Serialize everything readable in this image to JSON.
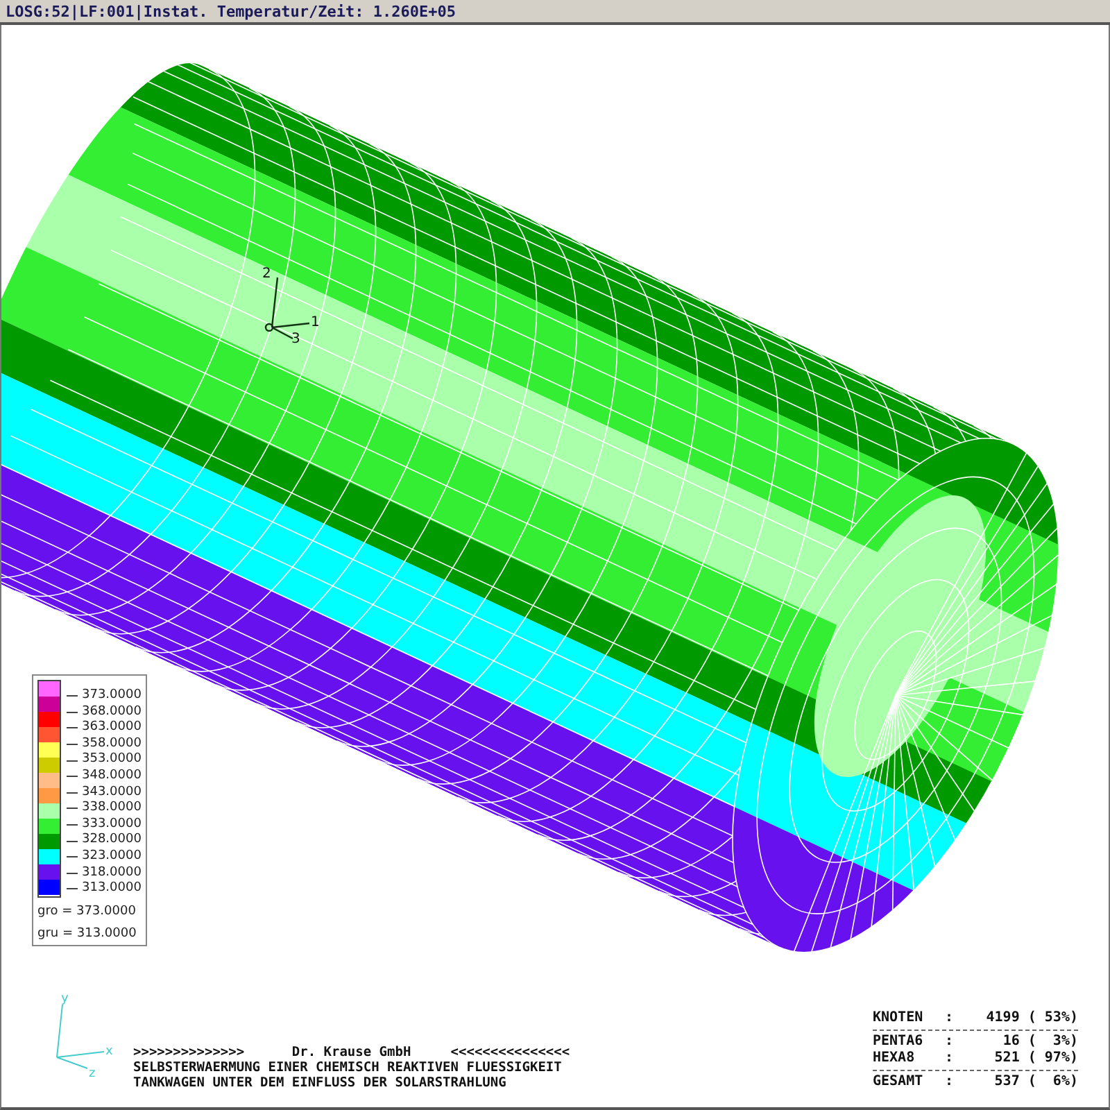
{
  "title_bar": {
    "text": "LOSG:52|LF:001|Instat. Temperatur/Zeit: 1.260E+05"
  },
  "model_triad": {
    "labels": [
      "2",
      "1",
      "3"
    ]
  },
  "legend": {
    "swatches": [
      {
        "color": "#ff66ff"
      },
      {
        "color": "#cc0099"
      },
      {
        "color": "#ff0000"
      },
      {
        "color": "#ff5533"
      },
      {
        "color": "#ffff55"
      },
      {
        "color": "#cccc00"
      },
      {
        "color": "#ffbb88"
      },
      {
        "color": "#ff9944"
      },
      {
        "color": "#aaffaa"
      },
      {
        "color": "#33ee33"
      },
      {
        "color": "#009900"
      },
      {
        "color": "#00ffff"
      },
      {
        "color": "#6611ee"
      },
      {
        "color": "#0000ff"
      }
    ],
    "levels": [
      "373.0000",
      "368.0000",
      "363.0000",
      "358.0000",
      "353.0000",
      "348.0000",
      "343.0000",
      "338.0000",
      "333.0000",
      "328.0000",
      "323.0000",
      "318.0000",
      "313.0000"
    ],
    "limits": [
      "gro = 373.0000",
      "gru = 313.0000"
    ]
  },
  "global_triad": {
    "labels": [
      "y",
      "x",
      "z"
    ]
  },
  "banner": {
    "lines": [
      ">>>>>>>>>>>>>>      Dr. Krause GmbH     <<<<<<<<<<<<<<<",
      "SELBSTERWAERMUNG EINER CHEMISCH REAKTIVEN FLUESSIGKEIT",
      "TANKWAGEN UNTER DEM EINFLUSS DER SOLARSTRAHLUNG"
    ]
  },
  "statistics": {
    "groups": [
      [
        {
          "label": "KNOTEN",
          "value": "4199 ( 53%)"
        }
      ],
      [
        {
          "label": "PENTA6",
          "value": "16 (  3%)"
        },
        {
          "label": "HEXA8",
          "value": "521 ( 97%)"
        }
      ],
      [
        {
          "label": "GESAMT",
          "value": "537 (  6%)"
        }
      ]
    ],
    "separator": ":"
  }
}
